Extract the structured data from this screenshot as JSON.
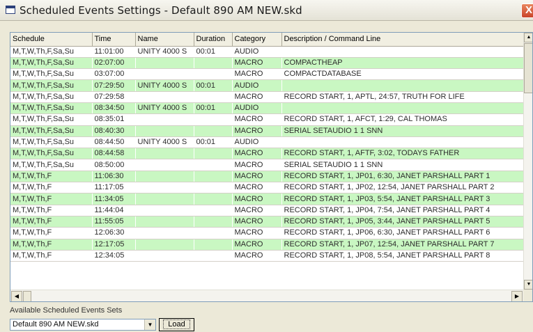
{
  "window": {
    "title": "Scheduled Events Settings - Default 890 AM NEW.skd",
    "close_glyph": "X"
  },
  "table": {
    "columns": [
      "Schedule",
      "Time",
      "Name",
      "Duration",
      "Category",
      "Description / Command Line"
    ],
    "rows": [
      [
        "M,T,W,Th,F,Sa,Su",
        "11:01:00",
        "UNITY 4000 S",
        "00:01",
        "AUDIO",
        ""
      ],
      [
        "M,T,W,Th,F,Sa,Su",
        "02:07:00",
        "",
        "",
        "MACRO",
        "COMPACTHEAP"
      ],
      [
        "M,T,W,Th,F,Sa,Su",
        "03:07:00",
        "",
        "",
        "MACRO",
        "COMPACTDATABASE"
      ],
      [
        "M,T,W,Th,F,Sa,Su",
        "07:29:50",
        "UNITY 4000 S",
        "00:01",
        "AUDIO",
        ""
      ],
      [
        "M,T,W,Th,F,Sa,Su",
        "07:29:58",
        "",
        "",
        "MACRO",
        "RECORD START, 1, APTL, 24:57, TRUTH FOR LIFE"
      ],
      [
        "M,T,W,Th,F,Sa,Su",
        "08:34:50",
        "UNITY 4000 S",
        "00:01",
        "AUDIO",
        ""
      ],
      [
        "M,T,W,Th,F,Sa,Su",
        "08:35:01",
        "",
        "",
        "MACRO",
        "RECORD START, 1, AFCT, 1:29, CAL THOMAS"
      ],
      [
        "M,T,W,Th,F,Sa,Su",
        "08:40:30",
        "",
        "",
        "MACRO",
        "SERIAL SETAUDIO 1 1 SNN"
      ],
      [
        "M,T,W,Th,F,Sa,Su",
        "08:44:50",
        "UNITY 4000 S",
        "00:01",
        "AUDIO",
        ""
      ],
      [
        "M,T,W,Th,F,Sa,Su",
        "08:44:58",
        "",
        "",
        "MACRO",
        "RECORD START, 1, AFTF, 3:02, TODAYS FATHER"
      ],
      [
        "M,T,W,Th,F,Sa,Su",
        "08:50:00",
        "",
        "",
        "MACRO",
        "SERIAL SETAUDIO 1 1 SNN"
      ],
      [
        "M,T,W,Th,F",
        "11:06:30",
        "",
        "",
        "MACRO",
        "RECORD START, 1, JP01, 6:30, JANET PARSHALL PART 1"
      ],
      [
        "M,T,W,Th,F",
        "11:17:05",
        "",
        "",
        "MACRO",
        "RECORD START, 1, JP02, 12:54, JANET PARSHALL PART 2"
      ],
      [
        "M,T,W,Th,F",
        "11:34:05",
        "",
        "",
        "MACRO",
        "RECORD START, 1, JP03, 5:54, JANET PARSHALL PART 3"
      ],
      [
        "M,T,W,Th,F",
        "11:44:04",
        "",
        "",
        "MACRO",
        "RECORD START, 1, JP04, 7:54, JANET PARSHALL PART 4"
      ],
      [
        "M,T,W,Th,F",
        "11:55:05",
        "",
        "",
        "MACRO",
        "RECORD START, 1, JP05, 3:44, JANET PARSHALL PART 5"
      ],
      [
        "M,T,W,Th,F",
        "12:06:30",
        "",
        "",
        "MACRO",
        "RECORD START, 1, JP06, 6:30, JANET PARSHALL PART 6"
      ],
      [
        "M,T,W,Th,F",
        "12:17:05",
        "",
        "",
        "MACRO",
        "RECORD START, 1, JP07, 12:54, JANET PARSHALL PART 7"
      ],
      [
        "M,T,W,Th,F",
        "12:34:05",
        "",
        "",
        "MACRO",
        "RECORD START, 1, JP08, 5:54, JANET PARSHALL PART 8"
      ]
    ]
  },
  "sets": {
    "label": "Available Scheduled Events Sets",
    "selected": "Default 890 AM NEW.skd",
    "load_label": "Load"
  },
  "colors": {
    "row_alt": "#c9f7c2",
    "row": "#ffffff"
  }
}
